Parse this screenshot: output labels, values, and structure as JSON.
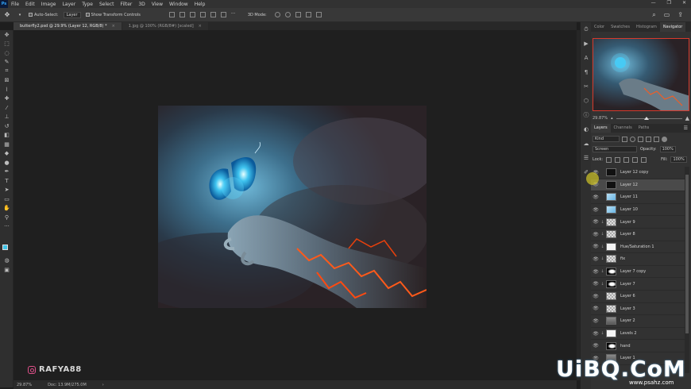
{
  "menubar": {
    "logo": "Ps",
    "items": [
      "File",
      "Edit",
      "Image",
      "Layer",
      "Type",
      "Select",
      "Filter",
      "3D",
      "View",
      "Window",
      "Help"
    ]
  },
  "options": {
    "auto_select_label": "Auto-Select:",
    "auto_select_target": "Layer",
    "transform_label": "Show Transform Controls",
    "mode_3d": "3D Mode:"
  },
  "doc_tabs": [
    {
      "label": "butterfly2.psd @ 29.9% (Layer 12, RGB/8) *",
      "active": true
    },
    {
      "label": "1.jpg @ 100% (RGB/8#) [scaled]",
      "active": false
    }
  ],
  "panel": {
    "tabs": [
      "Color",
      "Swatches",
      "Histogram",
      "Navigator"
    ],
    "active_tab": "Navigator",
    "zoom_value": "29.87%",
    "zoom_fraction": 0.46,
    "layers_tabs": [
      "Layers",
      "Channels",
      "Paths"
    ],
    "filter_kind": "Kind",
    "blend_mode": "Screen",
    "opacity_label": "Opacity:",
    "opacity_value": "100%",
    "lock_label": "Lock:",
    "fill_label": "Fill:",
    "fill_value": "100%"
  },
  "layers": [
    {
      "name": "Layer 12 copy",
      "thumb": "dark",
      "selected": false,
      "chain": false
    },
    {
      "name": "Layer 12",
      "thumb": "dark",
      "selected": true,
      "chain": false
    },
    {
      "name": "Layer 11",
      "thumb": "blue",
      "selected": false,
      "chain": false
    },
    {
      "name": "Layer 10",
      "thumb": "blue",
      "selected": false,
      "chain": false
    },
    {
      "name": "Layer 9",
      "thumb": "checker",
      "selected": false,
      "chain": true
    },
    {
      "name": "Layer 8",
      "thumb": "checker",
      "selected": false,
      "chain": true
    },
    {
      "name": "Hue/Saturation 1",
      "thumb": "white",
      "selected": false,
      "chain": true
    },
    {
      "name": "fix",
      "thumb": "checker",
      "selected": false,
      "chain": true
    },
    {
      "name": "Layer 7 copy",
      "thumb": "mask",
      "selected": false,
      "chain": true
    },
    {
      "name": "Layer 7",
      "thumb": "mask",
      "selected": false,
      "chain": true
    },
    {
      "name": "Layer 6",
      "thumb": "checker",
      "selected": false,
      "chain": false
    },
    {
      "name": "Layer 3",
      "thumb": "checker",
      "selected": false,
      "chain": false
    },
    {
      "name": "Layer 2",
      "thumb": "gray",
      "selected": false,
      "chain": false
    },
    {
      "name": "Levels 2",
      "thumb": "white",
      "selected": false,
      "chain": true
    },
    {
      "name": "hand",
      "thumb": "mask",
      "selected": false,
      "chain": false
    },
    {
      "name": "Layer 1",
      "thumb": "gray",
      "selected": false,
      "chain": false
    }
  ],
  "status": {
    "zoom": "29.87%",
    "doc": "Doc: 13.9M/275.0M"
  },
  "watermark": {
    "brand": "RAFYA88",
    "site": "UiBQ.CoM",
    "site_sub": "www.psahz.com"
  },
  "colors": {
    "foreground": "#40c4e8",
    "background": "#ffffff",
    "navigator_box": "#d83a2c"
  }
}
